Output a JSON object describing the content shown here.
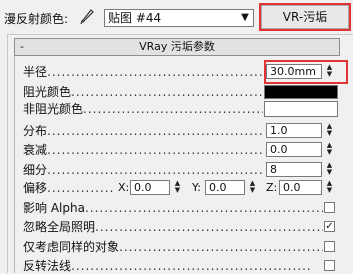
{
  "header": {
    "map_label": "漫反射颜色:",
    "map_select_value": "贴图 #44",
    "map_button_label": "VR-污垢"
  },
  "rollout": {
    "collapse_symbol": "-",
    "title": "VRay 污垢参数"
  },
  "params": {
    "radius": {
      "label": "半径",
      "value": "30.0mm"
    },
    "occluded_color": {
      "label": "阻光颜色",
      "color": "#000000"
    },
    "unoccluded_color": {
      "label": "非阻光颜色",
      "color": "#ffffff"
    },
    "distribution": {
      "label": "分布",
      "value": "1.0"
    },
    "falloff": {
      "label": "衰减",
      "value": "0.0"
    },
    "subdivs": {
      "label": "细分",
      "value": "8"
    },
    "bias": {
      "label": "偏移",
      "x_label": "X:",
      "x_value": "0.0",
      "y_label": "Y:",
      "y_value": "0.0",
      "z_label": "Z:",
      "z_value": "0.0"
    },
    "affect_alpha": {
      "label": "影响 Alpha",
      "checked": false
    },
    "ignore_gi": {
      "label": "忽略全局照明",
      "checked": true,
      "mark": "✓"
    },
    "same_object_only": {
      "label": "仅考虑同样的对象",
      "checked": false
    },
    "invert_normal": {
      "label": "反转法线",
      "checked": false
    }
  },
  "dots": "..................................................",
  "highlight_color": "#e03333"
}
